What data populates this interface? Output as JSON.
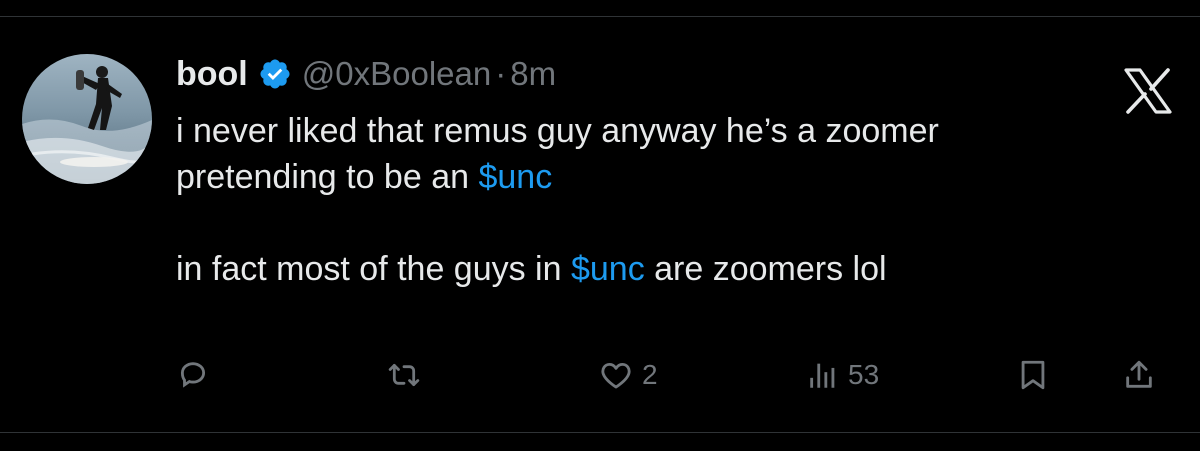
{
  "author": {
    "name": "bool",
    "handle": "@0xBoolean",
    "separator": "·",
    "time": "8m",
    "verified": true
  },
  "tweet": {
    "line1": "i never liked that remus guy anyway he’s a zoomer",
    "line2_prefix": "pretending to be an ",
    "line2_cashtag": "$unc",
    "line3_prefix": "in fact most of the guys in ",
    "line3_cashtag": "$unc",
    "line3_suffix": " are zoomers lol"
  },
  "actions": {
    "reply": {
      "icon": "reply-icon",
      "count": ""
    },
    "repost": {
      "icon": "repost-icon",
      "count": ""
    },
    "like": {
      "icon": "heart-icon",
      "count": "2"
    },
    "views": {
      "icon": "views-icon",
      "count": "53"
    },
    "bookmark": {
      "icon": "bookmark-icon"
    },
    "share": {
      "icon": "share-icon"
    }
  },
  "colors": {
    "background": "#000000",
    "text": "#e7e9ea",
    "muted": "#71767b",
    "accent": "#1d9bf0",
    "divider": "#2f3336"
  },
  "platform_logo": "x-logo"
}
